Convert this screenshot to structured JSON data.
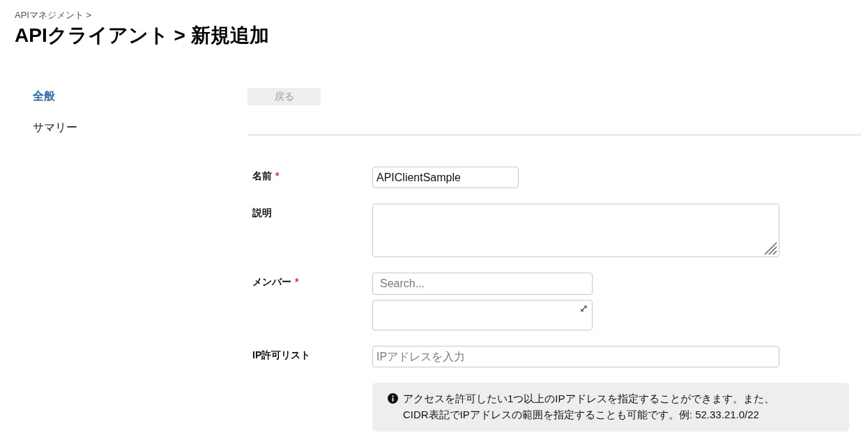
{
  "breadcrumb": "APIマネジメント >",
  "title": "APIクライアント > 新規追加",
  "sidebar": {
    "items": [
      {
        "label": "全般",
        "selected": true
      },
      {
        "label": "サマリー",
        "selected": false
      }
    ]
  },
  "back_button": {
    "label": "戻る",
    "disabled": true
  },
  "form": {
    "fields": [
      {
        "kind": "text",
        "label": "名前",
        "required_mark": "*",
        "value": "APIClientSample"
      },
      {
        "kind": "textarea",
        "label": "説明"
      },
      {
        "kind": "member",
        "label": "メンバー",
        "required_mark": "*",
        "placeholder": "Search..."
      },
      {
        "kind": "text",
        "label": "IP許可リスト",
        "placeholder": "IPアドレスを入力",
        "note": "アクセスを許可したい1つ以上のIPアドレスを指定することができます。また、CIDR表記でIPアドレスの範囲を指定することも可能です。例: 52.33.21.0/22"
      }
    ]
  }
}
